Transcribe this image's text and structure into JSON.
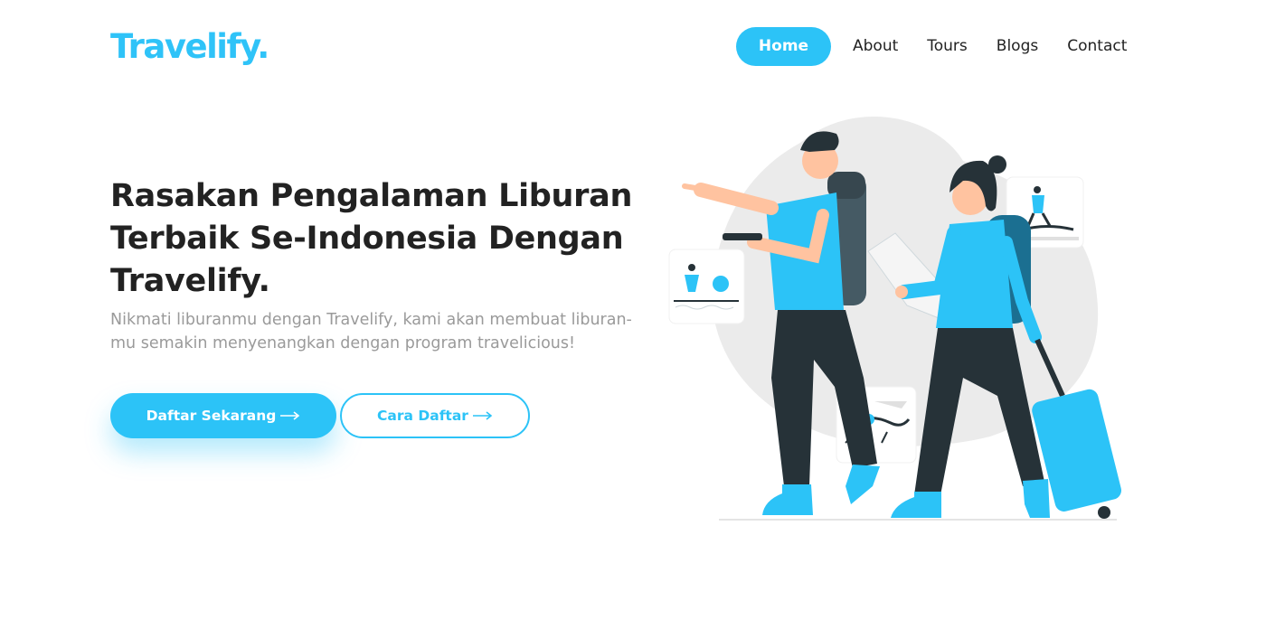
{
  "brand": {
    "name": "Travelify."
  },
  "nav": {
    "items": [
      {
        "label": "Home",
        "active": true
      },
      {
        "label": "About"
      },
      {
        "label": "Tours"
      },
      {
        "label": "Blogs"
      },
      {
        "label": "Contact"
      }
    ]
  },
  "hero": {
    "title": "Rasakan Pengalaman Liburan Terbaik Se-Indonesia Dengan Travelify.",
    "description": "Nikmati liburanmu dengan Travelify, kami akan membuat liburan-mu semakin menyenangkan dengan program travelicious!",
    "primary_button": "Daftar Sekarang",
    "secondary_button": "Cara Daftar",
    "arrow_icon": "long-arrow-right-icon"
  },
  "colors": {
    "accent": "#2cc3f7",
    "text_dark": "#222222",
    "text_muted": "#9a9a9a",
    "illustration_gray": "#ebebeb",
    "illustration_dark": "#263238"
  }
}
